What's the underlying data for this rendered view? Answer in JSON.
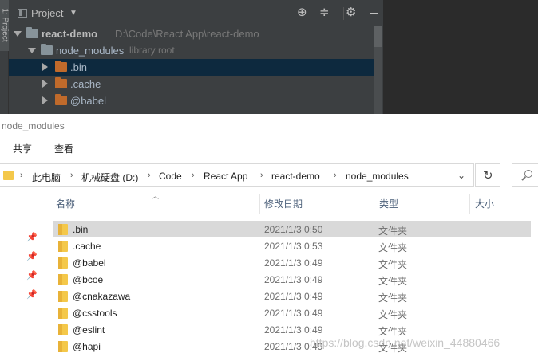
{
  "ide": {
    "side_tab_label": "1: Project",
    "panel_title": "Project",
    "tree": [
      {
        "name": "react-demo",
        "hint": "D:\\Code\\React App\\react-demo",
        "level": 0,
        "expanded": true,
        "folder_color": "gray",
        "bold": true
      },
      {
        "name": "node_modules",
        "hint": "library root",
        "level": 1,
        "expanded": true,
        "folder_color": "gray",
        "bold": false
      },
      {
        "name": ".bin",
        "hint": "",
        "level": 2,
        "expanded": false,
        "folder_color": "orange",
        "bold": false,
        "selected": true
      },
      {
        "name": ".cache",
        "hint": "",
        "level": 2,
        "expanded": false,
        "folder_color": "orange",
        "bold": false
      },
      {
        "name": "@babel",
        "hint": "",
        "level": 2,
        "expanded": false,
        "folder_color": "orange",
        "bold": false
      }
    ]
  },
  "explorer": {
    "window_title": "node_modules",
    "ribbon_tabs": [
      "共享",
      "查看"
    ],
    "breadcrumb": [
      "此电脑",
      "机械硬盘 (D:)",
      "Code",
      "React App",
      "react-demo",
      "node_modules"
    ],
    "columns": {
      "name": "名称",
      "date": "修改日期",
      "type": "类型",
      "size": "大小"
    },
    "files": [
      {
        "name": ".bin",
        "date": "2021/1/3 0:50",
        "type": "文件夹",
        "selected": true
      },
      {
        "name": ".cache",
        "date": "2021/1/3 0:53",
        "type": "文件夹"
      },
      {
        "name": "@babel",
        "date": "2021/1/3 0:49",
        "type": "文件夹"
      },
      {
        "name": "@bcoe",
        "date": "2021/1/3 0:49",
        "type": "文件夹"
      },
      {
        "name": "@cnakazawa",
        "date": "2021/1/3 0:49",
        "type": "文件夹"
      },
      {
        "name": "@csstools",
        "date": "2021/1/3 0:49",
        "type": "文件夹"
      },
      {
        "name": "@eslint",
        "date": "2021/1/3 0:49",
        "type": "文件夹"
      },
      {
        "name": "@hapi",
        "date": "2021/1/3 0:49",
        "type": "文件夹"
      }
    ]
  },
  "watermark": "https://blog.csdn.net/weixin_44880466",
  "colors": {
    "ide_bg": "#3c3f41",
    "ide_selection": "#0d293e",
    "folder_orange": "#c06a2b",
    "explorer_selection": "#d9d9d9",
    "folder_yellow": "#f4c84a"
  }
}
